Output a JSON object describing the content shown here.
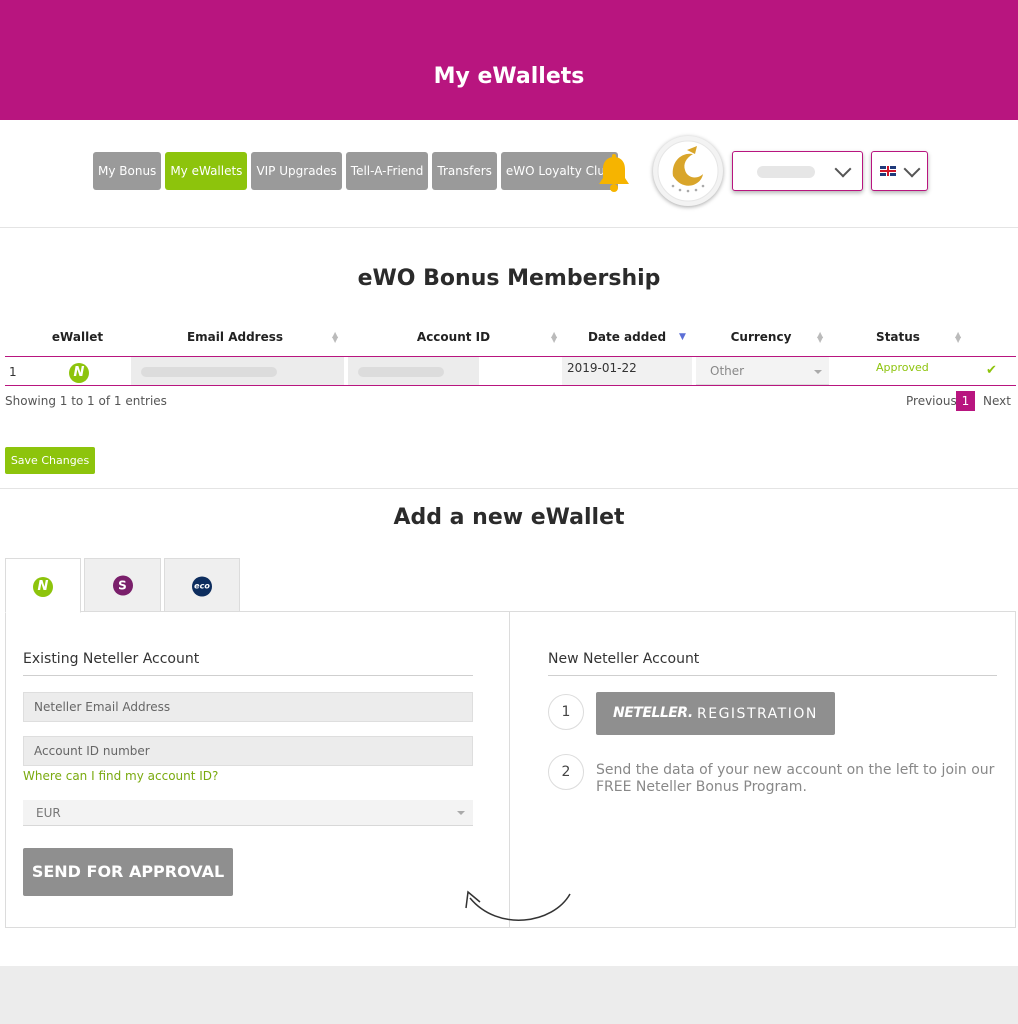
{
  "header": {
    "title": "My eWallets"
  },
  "nav": {
    "items": [
      {
        "label": "My Bonus"
      },
      {
        "label": "My eWallets"
      },
      {
        "label": "VIP Upgrades"
      },
      {
        "label": "Tell-A-Friend"
      },
      {
        "label": "Transfers"
      },
      {
        "label": "eWO Loyalty Club"
      }
    ],
    "active": "My eWallets"
  },
  "membership": {
    "title": "eWO Bonus Membership",
    "columns": [
      "eWallet",
      "Email Address",
      "Account ID",
      "Date added",
      "Currency",
      "Status"
    ],
    "rows": [
      {
        "index": "1",
        "wallet_icon": "N",
        "email": "",
        "account_id": "",
        "date_added": "2019-01-22",
        "currency": "Other",
        "status": "Approved"
      }
    ],
    "showing": "Showing 1 to 1 of 1 entries",
    "pagination": {
      "previous": "Previous",
      "page": "1",
      "next": "Next"
    },
    "save_label": "Save Changes"
  },
  "add_wallet": {
    "title": "Add a new eWallet",
    "tabs": [
      {
        "icon": "N"
      },
      {
        "icon": "S"
      },
      {
        "icon": "eco"
      }
    ],
    "existing": {
      "title": "Existing Neteller Account",
      "email_placeholder": "Neteller Email Address",
      "account_placeholder": "Account ID number",
      "help_link": "Where can I find my account ID?",
      "currency": "EUR",
      "submit": "SEND FOR APPROVAL"
    },
    "new": {
      "title": "New Neteller Account",
      "step1": "1",
      "step2": "2",
      "reg_brand": "NETELLER.",
      "reg_word": "REGISTRATION",
      "step2_text": "Send the data of your new account on the left to join our FREE Neteller Bonus Program."
    }
  },
  "colors": {
    "brand": "#b8157f",
    "accent": "#8dc40c",
    "button_gray": "#9a9a9a"
  }
}
